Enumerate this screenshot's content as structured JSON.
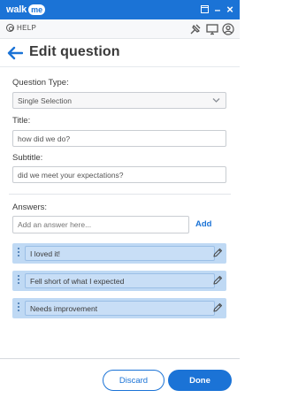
{
  "app": {
    "logo_text": "walk",
    "logo_badge": "me",
    "minimize_glyph": "–",
    "close_glyph": "×"
  },
  "toolbar": {
    "help_label": "HELP"
  },
  "header": {
    "title": "Edit question"
  },
  "form": {
    "question_type_label": "Question Type:",
    "question_type_value": "Single Selection",
    "title_label": "Title:",
    "title_value": "how did we do?",
    "subtitle_label": "Subtitle:",
    "subtitle_value": "did we meet your expectations?",
    "answers_label": "Answers:",
    "answer_placeholder": "Add an answer here...",
    "add_label": "Add"
  },
  "answers": [
    {
      "label": "I loved it!"
    },
    {
      "label": "Fell short of what I expected"
    },
    {
      "label": "Needs improvement"
    }
  ],
  "footer": {
    "discard_label": "Discard",
    "done_label": "Done"
  },
  "colors": {
    "brand": "#1b73d6",
    "answer_row_bg": "#bfd9f4"
  },
  "icons": [
    "help-icon",
    "pin-icon",
    "monitor-icon",
    "user-icon",
    "back-arrow-icon",
    "chevron-down-icon",
    "drag-handle-icon",
    "pencil-icon"
  ]
}
